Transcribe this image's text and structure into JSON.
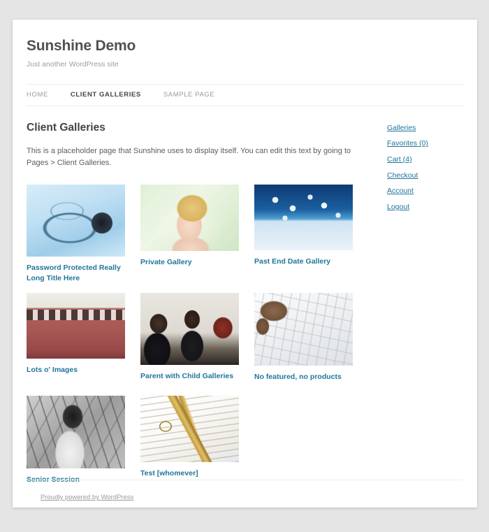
{
  "site": {
    "title": "Sunshine Demo",
    "description": "Just another WordPress site"
  },
  "nav": {
    "items": [
      {
        "label": "HOME",
        "active": false
      },
      {
        "label": "CLIENT GALLERIES",
        "active": true
      },
      {
        "label": "SAMPLE PAGE",
        "active": false
      }
    ]
  },
  "page": {
    "title": "Client Galleries",
    "intro": "This is a placeholder page that Sunshine uses to display itself. You can edit this text by going to Pages > Client Galleries."
  },
  "galleries": {
    "rows": [
      [
        {
          "caption": "Password Protected Really Long Title Here",
          "thumb": "stethoscope-thumbnail",
          "thumb_class": "t-stethoscope",
          "thumb_height": 103
        },
        {
          "caption": "Private Gallery",
          "thumb": "woman-portrait-thumbnail",
          "thumb_class": "t-woman",
          "thumb_height": 95
        },
        {
          "caption": "Past End Date Gallery",
          "thumb": "jigsaw-puzzle-thumbnail",
          "thumb_class": "t-puzzle",
          "thumb_height": 94
        }
      ],
      [
        {
          "caption": "Lots o' Images",
          "thumb": "vintage-train-thumbnail",
          "thumb_class": "t-train",
          "thumb_height": 94
        },
        {
          "caption": "Parent with Child Galleries",
          "thumb": "business-meeting-thumbnail",
          "thumb_class": "t-meeting",
          "thumb_height": 103
        },
        {
          "caption": "No featured, no products",
          "thumb": "keyboard-typing-thumbnail",
          "thumb_class": "t-keyboard",
          "thumb_height": 104
        }
      ],
      [
        {
          "caption": "Senior Session",
          "thumb": "senior-portrait-thumbnail",
          "thumb_class": "t-senior",
          "thumb_height": 104
        },
        {
          "caption": "Test [whomever]",
          "thumb": "keys-on-document-thumbnail",
          "thumb_class": "t-keys",
          "thumb_height": 95
        }
      ]
    ]
  },
  "sidebar": {
    "links": [
      {
        "label": "Galleries"
      },
      {
        "label": "Favorites (0)"
      },
      {
        "label": "Cart (4)"
      },
      {
        "label": "Checkout"
      },
      {
        "label": "Account"
      },
      {
        "label": "Logout"
      }
    ]
  },
  "footer": {
    "credit": "Proudly powered by WordPress"
  },
  "colors": {
    "link": "#21759b",
    "text": "#5d5d5d",
    "heading": "#434343",
    "muted": "#9a9a9a",
    "page_bg": "#ffffff",
    "canvas_bg": "#e5e5e5",
    "rule": "#ededed"
  }
}
